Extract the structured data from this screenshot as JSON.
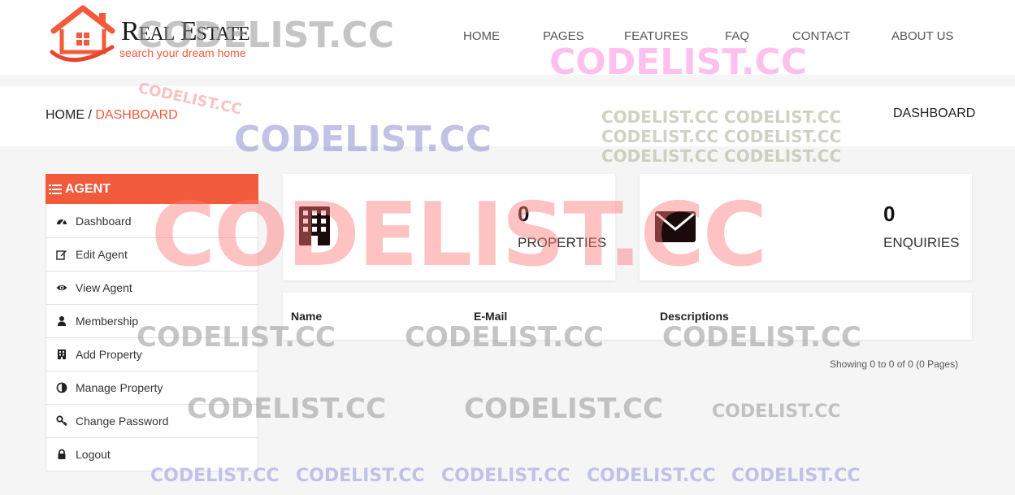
{
  "brand": {
    "title": "Real Estate",
    "tagline": "search your dream home",
    "accent_color": "#f15a3a"
  },
  "nav": {
    "items": [
      {
        "label": "HOME"
      },
      {
        "label": "PAGES"
      },
      {
        "label": "FEATURES"
      },
      {
        "label": "FAQ"
      },
      {
        "label": "CONTACT"
      },
      {
        "label": "ABOUT US"
      }
    ]
  },
  "breadcrumb": {
    "home": "HOME",
    "separator": "/",
    "current": "DASHBOARD",
    "page_title": "DASHBOARD"
  },
  "sidebar": {
    "header": "AGENT",
    "items": [
      {
        "label": "Dashboard",
        "icon": "dashboard-icon"
      },
      {
        "label": "Edit Agent",
        "icon": "edit-icon"
      },
      {
        "label": "View Agent",
        "icon": "eye-icon"
      },
      {
        "label": "Membership",
        "icon": "user-icon"
      },
      {
        "label": "Add Property",
        "icon": "building-icon"
      },
      {
        "label": "Manage Property",
        "icon": "contrast-icon"
      },
      {
        "label": "Change Password",
        "icon": "key-icon"
      },
      {
        "label": "Logout",
        "icon": "lock-icon"
      }
    ]
  },
  "stats": {
    "properties": {
      "value": "0",
      "label": "PROPERTIES",
      "icon": "building-icon"
    },
    "enquiries": {
      "value": "0",
      "label": "ENQUIRIES",
      "icon": "envelope-icon"
    }
  },
  "table": {
    "columns": [
      "Name",
      "E-Mail",
      "Descriptions"
    ],
    "rows": [],
    "showing": "Showing 0 to 0 of 0 (0 Pages)"
  },
  "watermarks": {
    "text": "CODELIST.CC",
    "double": "CODELIST.CC CODELIST.CC"
  }
}
